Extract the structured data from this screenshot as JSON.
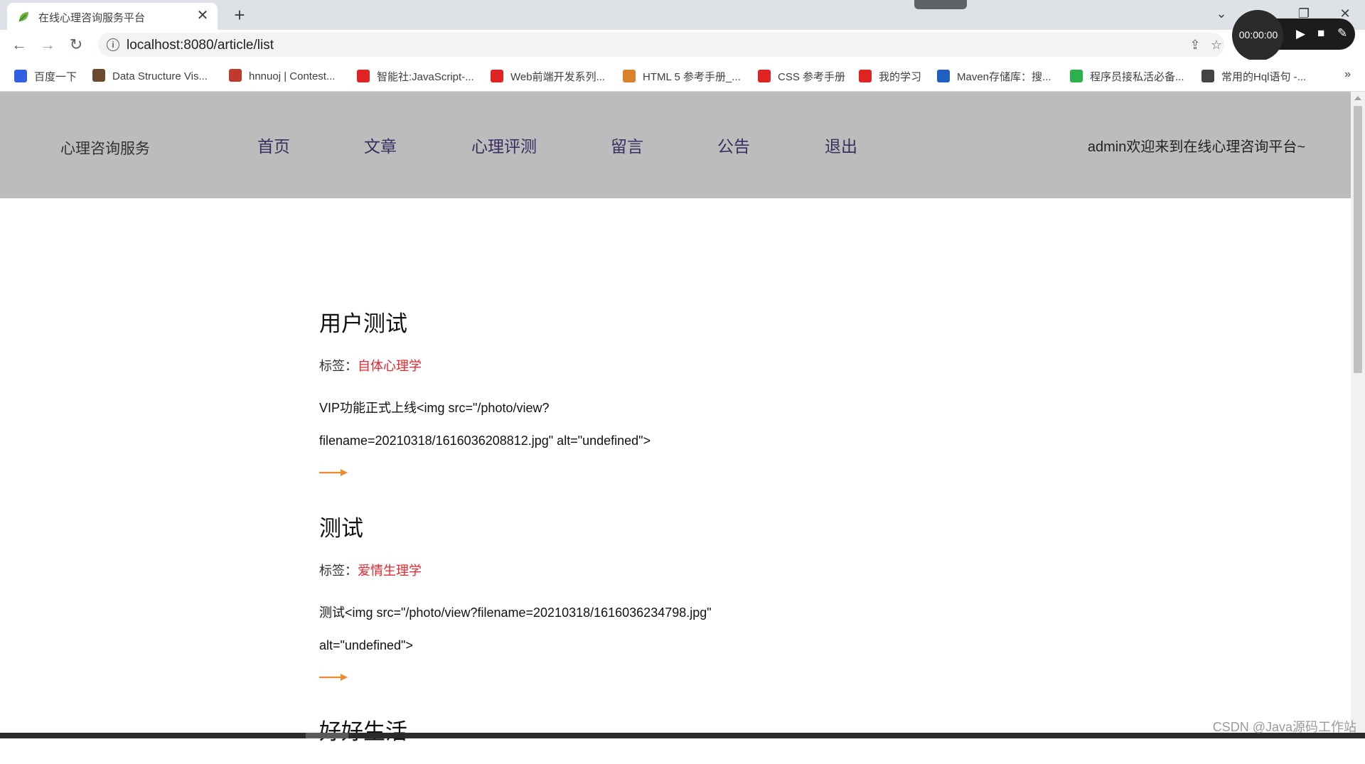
{
  "browser": {
    "tab_title": "在线心理咨询服务平台",
    "tab_close": "✕",
    "new_tab": "+",
    "window_controls": {
      "dropdown": "⌄",
      "restore": "❐",
      "close": "✕"
    },
    "url": "localhost:8080/article/list",
    "recorder": {
      "time": "00:00:00"
    },
    "bookmarks": [
      {
        "label": "百度一下",
        "color": "#3060e0"
      },
      {
        "label": "Data Structure Vis...",
        "color": "#6b4a2e"
      },
      {
        "label": "hnnuoj | Contest...",
        "color": "#c0392b"
      },
      {
        "label": "智能社:JavaScript-...",
        "color": "#e02424"
      },
      {
        "label": "Web前端开发系列...",
        "color": "#e02424"
      },
      {
        "label": "HTML 5 参考手册_...",
        "color": "#d9822b"
      },
      {
        "label": "CSS 参考手册",
        "color": "#e02424"
      },
      {
        "label": "我的学习",
        "color": "#e02424"
      },
      {
        "label": "Maven存储库：搜...",
        "color": "#1f5fbf"
      },
      {
        "label": "程序员接私活必备...",
        "color": "#2bb24c"
      },
      {
        "label": "常用的Hql语句 -...",
        "color": "#444444"
      }
    ],
    "bookmarks_more": "»"
  },
  "header": {
    "logo": "心理咨询服务",
    "nav": [
      "首页",
      "文章",
      "心理评测",
      "留言",
      "公告",
      "退出"
    ],
    "welcome": "admin欢迎来到在线心理咨询平台~"
  },
  "articles": [
    {
      "title": "用户测试",
      "tag_label": "标签：",
      "tag": "自体心理学",
      "body": "VIP功能正式上线<img src=\"/photo/view?filename=20210318/1616036208812.jpg\" alt=\"undefined\">"
    },
    {
      "title": "测试",
      "tag_label": "标签：",
      "tag": "爱情生理学",
      "body": "测试<img src=\"/photo/view?filename=20210318/1616036234798.jpg\" alt=\"undefined\">"
    },
    {
      "title": "好好生活"
    }
  ],
  "watermark": "CSDN @Java源码工作站",
  "colors": {
    "header_bg": "#bcbcbc",
    "nav_text": "#3a2d5f",
    "tag_red": "#e8262d",
    "arrow_orange": "#f08a2c"
  }
}
